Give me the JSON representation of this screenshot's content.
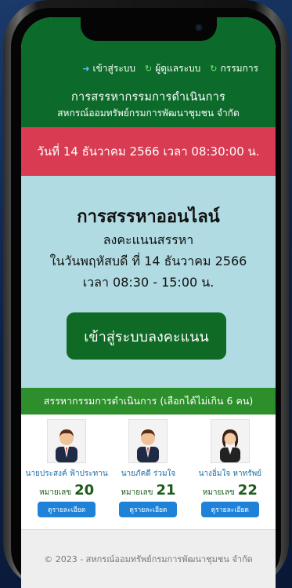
{
  "nav": {
    "items": [
      {
        "label": "เข้าสู่ระบบ",
        "icon": "login-icon"
      },
      {
        "label": "ผู้ดูแลระบบ",
        "icon": "leaf-icon"
      },
      {
        "label": "กรรมการ",
        "icon": "leaf-icon"
      }
    ]
  },
  "header": {
    "title": "การสรรหากรรมการดำเนินการ",
    "subtitle": "สหกรณ์ออมทรัพย์กรมการพัฒนาชุมชน จำกัด"
  },
  "datebar": {
    "text": "วันที่ 14 ธันวาคม 2566 เวลา 08:30:00 น."
  },
  "hero": {
    "title": "การสรรหาออนไลน์",
    "subtitle": "ลงคะแนนสรรหา",
    "date": "ในวันพฤหัสบดี ที่ 14 ธันวาคม 2566",
    "time": "เวลา 08:30 - 15:00 น.",
    "button": "เข้าสู่ระบบลงคะแนน"
  },
  "candidates": {
    "heading": "สรรหากรรมการดำเนินการ (เลือกได้ไม่เกิน 6 คน)",
    "number_label": "หมายเลข",
    "detail_label": "ดูรายละเอียด",
    "items": [
      {
        "name": "นายประสงค์ ฟ้าประทาน",
        "number": "20",
        "gender": "male"
      },
      {
        "name": "นายภัคดี ร่วมใจ",
        "number": "21",
        "gender": "male"
      },
      {
        "name": "นางอิ่มใจ หาทรัพย์",
        "number": "22",
        "gender": "female"
      }
    ]
  },
  "footer": {
    "text": "© 2023 - สหกรณ์ออมทรัพย์กรมการพัฒนาชุมชน จำกัด"
  },
  "colors": {
    "header_green": "#0c6b2a",
    "date_red": "#d93c52",
    "hero_blue": "#b0dbe2",
    "button_green": "#0e6a24",
    "section_green": "#2d8e2c",
    "detail_blue": "#1e82d8"
  }
}
